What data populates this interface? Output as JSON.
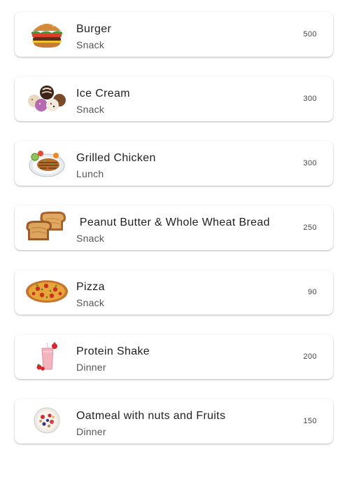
{
  "items": [
    {
      "title": "Burger",
      "category": "Snack",
      "calories": "500",
      "icon": "burger-icon"
    },
    {
      "title": "Ice Cream",
      "category": "Snack",
      "calories": "300",
      "icon": "ice-cream-icon"
    },
    {
      "title": "Grilled Chicken",
      "category": "Lunch",
      "calories": "300",
      "icon": "grilled-chicken-icon"
    },
    {
      "title": " Peanut Butter & Whole Wheat Bread",
      "category": "Snack",
      "calories": "250",
      "icon": "peanut-butter-bread-icon"
    },
    {
      "title": "Pizza",
      "category": "Snack",
      "calories": "90",
      "icon": "pizza-icon"
    },
    {
      "title": "Protein Shake",
      "category": "Dinner",
      "calories": "200",
      "icon": "protein-shake-icon"
    },
    {
      "title": "Oatmeal with nuts and Fruits",
      "category": "Dinner",
      "calories": "150",
      "icon": "oatmeal-bowl-icon"
    }
  ]
}
